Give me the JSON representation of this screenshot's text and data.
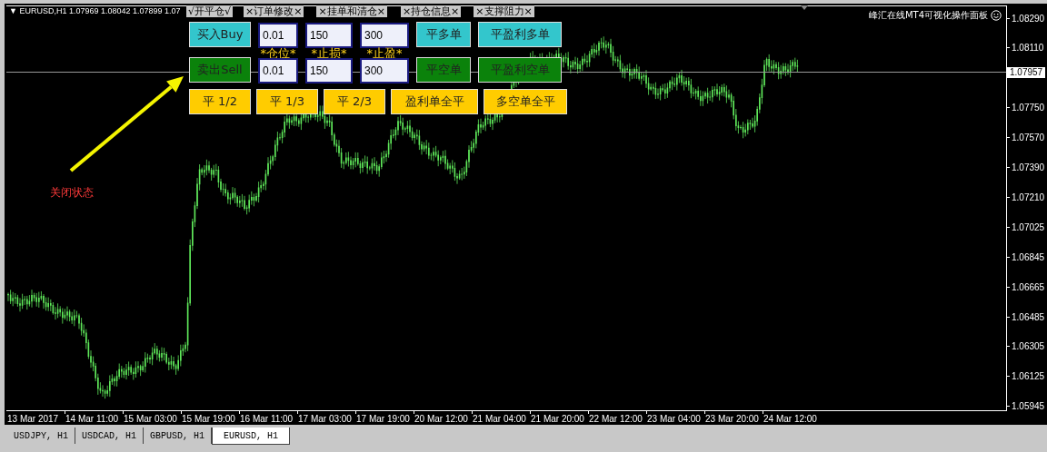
{
  "chart": {
    "header": "▼ EURUSD,H1  1.07969 1.08042 1.07899 1.07",
    "title": "峰汇在线MT4可视化操作面板",
    "current_price": "1.07957",
    "price_ticks": [
      "1.08290",
      "1.08110",
      "1.07750",
      "1.07570",
      "1.07390",
      "1.07210",
      "1.07025",
      "1.06845",
      "1.06665",
      "1.06485",
      "1.06305",
      "1.06125",
      "1.05945"
    ],
    "time_ticks": [
      "13 Mar 2017",
      "14 Mar 11:00",
      "15 Mar 03:00",
      "15 Mar 19:00",
      "16 Mar 11:00",
      "17 Mar 03:00",
      "17 Mar 19:00",
      "20 Mar 12:00",
      "21 Mar 04:00",
      "21 Mar 20:00",
      "22 Mar 12:00",
      "23 Mar 04:00",
      "23 Mar 20:00",
      "24 Mar 12:00"
    ]
  },
  "panel": {
    "tabs": [
      {
        "label": "√开平仓√"
      },
      {
        "label": "×订单修改×"
      },
      {
        "label": "×挂单和清仓×"
      },
      {
        "label": "×持仓信息×"
      },
      {
        "label": "×支撑阻力×"
      }
    ],
    "rows": [
      [
        {
          "kind": "button",
          "label": "买入Buy",
          "color": "#33c6cc"
        },
        {
          "kind": "field",
          "value": "0.01"
        },
        {
          "kind": "field",
          "value": "150"
        },
        {
          "kind": "field",
          "value": "300"
        },
        {
          "kind": "button",
          "label": "平多单",
          "color": "#33c6cc"
        },
        {
          "kind": "button",
          "label": "平盈利多单",
          "color": "#33c6cc"
        }
      ],
      [
        {
          "kind": "empty"
        },
        {
          "kind": "label",
          "label": "*仓位*"
        },
        {
          "kind": "label",
          "label": "*止损*"
        },
        {
          "kind": "label",
          "label": "*止盈*"
        },
        {
          "kind": "empty"
        },
        {
          "kind": "empty"
        }
      ],
      [
        {
          "kind": "button",
          "label": "卖出Sell",
          "color": "#0b820b"
        },
        {
          "kind": "field",
          "value": "0.01"
        },
        {
          "kind": "field",
          "value": "150"
        },
        {
          "kind": "field",
          "value": "300"
        },
        {
          "kind": "button",
          "label": "平空单",
          "color": "#0b820b"
        },
        {
          "kind": "button",
          "label": "平盈利空单",
          "color": "#0b820b"
        }
      ]
    ],
    "close_buttons": [
      {
        "kind": "button",
        "label": "平 1/2",
        "color": "#ffcc00"
      },
      {
        "kind": "button",
        "label": "平 1/3",
        "color": "#ffcc00"
      },
      {
        "kind": "button",
        "label": "平 2/3",
        "color": "#ffcc00"
      },
      {
        "kind": "button",
        "label": "盈利单全平",
        "color": "#ffcc00"
      },
      {
        "kind": "button",
        "label": "多空单全平",
        "color": "#ffcc00"
      }
    ]
  },
  "annotation": {
    "text": "关闭状态"
  },
  "symbol_tabs": [
    {
      "label": "USDJPY, H1",
      "selected": false
    },
    {
      "label": "USDCAD, H1",
      "selected": false
    },
    {
      "label": "GBPUSD, H1",
      "selected": false
    },
    {
      "label": "EURUSD, H1",
      "selected": true
    }
  ]
}
